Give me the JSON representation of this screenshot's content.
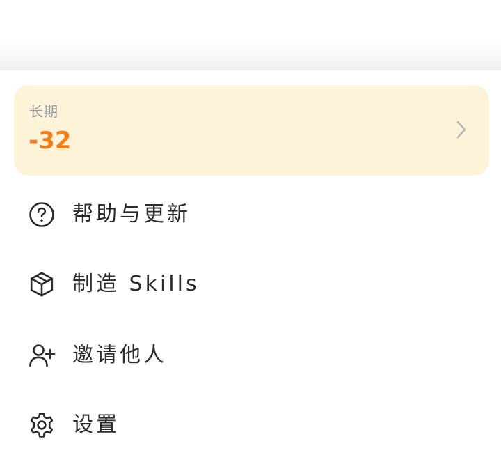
{
  "card": {
    "label": "长期",
    "value": "-32",
    "chevron_icon": "chevron-right-icon",
    "value_color": "#ee7d1c",
    "background_color": "#fdf3d9"
  },
  "menu": {
    "items": [
      {
        "label": "帮助与更新",
        "icon": "help-circle-icon"
      },
      {
        "label": "制造 Skills",
        "icon": "cube-icon"
      },
      {
        "label": "邀请他人",
        "icon": "user-plus-icon"
      },
      {
        "label": "设置",
        "icon": "gear-icon"
      }
    ]
  }
}
